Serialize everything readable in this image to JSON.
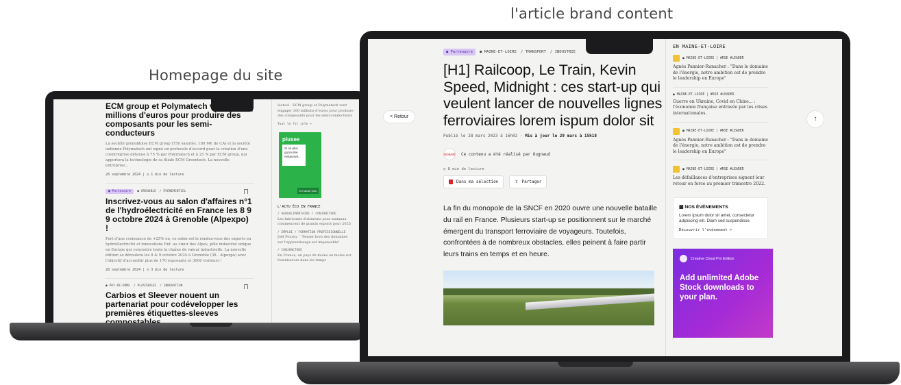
{
  "captions": {
    "left": "Homepage du site",
    "right": "l'article brand content"
  },
  "homepage": {
    "article1": {
      "title": "ECM group et Polymatech vont ████ millions d'euros pour produire des composants pour les semi-conducteurs",
      "excerpt": "La société grenobloise ECM group (750 salariés, 180 M€ de CA) et la société indienne Polymatech ont signé un protocole d'accord pour la création d'une coentreprise détenue à 75 % par Polymatech et à 25 % par ECM group, qui apportera la technologie de sa filiale ECM Greentech. La nouvelle entreprise...",
      "meta": "28 septembre 2024 | ◷ 1 min de lecture"
    },
    "article2": {
      "tags": [
        "● Partenaire",
        "● GRENOBLE",
        "/ ÉVÉNEMENTIEL"
      ],
      "title": "Inscrivez-vous au salon d'affaires n°1 de l'hydroélectricité en France les 8 9 9 octobre 2024 à Grenoble (Alpexpo) !",
      "excerpt": "Fort d'une croissance de +25% en, ce salon est le rendez-vous des experts en hydroélectricité et innovations Enf. au cœur des Alpes, pôle industriel unique en Europe qui concentre toute la chaîne de valeur industrielle. La nouvelle édition se déroulera les 8 & 9 octobre 2024 à Grenoble (38 - Alpexpo) avec l'objectif d'accueillir plus de 170 exposants et 3000 visiteurs !",
      "meta": "28 septembre 2024 | ◷ 3 min de lecture"
    },
    "article3": {
      "tags": [
        "● PUY-DE-DÔME",
        "/ PLASTURGIE",
        "/ INNOVATION"
      ],
      "title": "Carbios et Sleever nouent un partenariat pour codévelopper les premières étiquettes-sleeves compostables"
    },
    "side": {
      "top_text": "Isotool · ECM group et Polymatech vont engager 100 millions d'euros pour produire des composants pour les semi-conducteurs",
      "read_more": "Tout le fil info →",
      "ad_logo": "pluxee",
      "ad_card": "Si on plus qu'un titre restaurant...",
      "ad_cta": "En savoir plus",
      "section": "L'ACTU ÉCO EN FRANCE",
      "item1_tags": "/ AGROALIMENTAIRE / CONJONCTURE",
      "item1": "Les fabricants d'aliments pour animaux commencent de grands espoirs pour 2025",
      "item2_tags": "/ EMPLOI / FORMATION PROFESSIONNELLE",
      "item2": "Joël Fourny · \"Penser hors des domaines sur l'apprentissage est impensable\"",
      "item3_tags": "/ CONJONCTURE",
      "item3": "En France, un pays de moins en moins sur fournisseurs dans les temps"
    }
  },
  "article": {
    "back_label": "< Retour",
    "up_label": "↑",
    "tags": [
      "● Partenaire",
      "● MAINE-ET-LOIRE",
      "/ TRANSPORT",
      "/ INDUSTRIE"
    ],
    "title": "[H1] Railcoop, Le Train, Kevin Speed, Midnight : ces start-up qui veulent lancer de nouvelles lignes ferroviaires lorem ispum dolor sit",
    "date_published": "Publié le 28 mars 2023 à 16h02 ·",
    "date_updated": "Mis à jour le 29 mars à 15h18",
    "sponsor_logo": "OUGNAUD",
    "sponsor_text": "Ce contenu a été réalisé par Ougnaud",
    "read_time": "◷ 8 min de lecture",
    "btn_selection": "Dans ma sélection",
    "btn_share": "Partager",
    "lead": "La fin du monopole de la SNCF en 2020 ouvre une nouvelle bataille du rail en France. Plusieurs start-up se positionnent sur le marché émergent du transport ferroviaire de voyageurs. Toutefois, confrontées à de nombreux obstacles, elles peinent à faire partir leurs trains en temps et en heure."
  },
  "sidebar": {
    "heading": "EN MAINE-ET-LOIRE",
    "items": [
      {
        "tags": "● MAINE-ET-LOIRE | #RSE #LEADER",
        "text": "Agnès Pannier-Runacher : \"Dans le domaine de l'énergie, notre ambition est de prendre le leadership en Europe\""
      },
      {
        "tags": "● MAINE-ET-LOIRE | #RSE #LEADER",
        "text": "Guerre en Ukraine, Covid en Chine... : l'économie française entravée par les crises internationales."
      },
      {
        "tags": "● MAINE-ET-LOIRE | #RSE #LEADER",
        "text": "Agnès Pannier-Runacher : \"Dans le domaine de l'énergie, notre ambition est de prendre le leadership en Europe\""
      },
      {
        "tags": "● MAINE-ET-LOIRE | #RSE #LEADER",
        "text": "Les défaillances d'entreprises signent leur retour en force au premier trimestre 2022."
      }
    ],
    "events": {
      "heading": "NOS ÉVÉNEMENTS",
      "text": "Lorem ipsum dolor sit amet, consectetur adipiscing elit. Diam sed suspendisse.",
      "link": "Découvrir l'événement >"
    },
    "promo": {
      "eyebrow": "Creative Cloud Pro Edition",
      "headline": "Add unlimited Adobe Stock downloads to your plan."
    }
  }
}
